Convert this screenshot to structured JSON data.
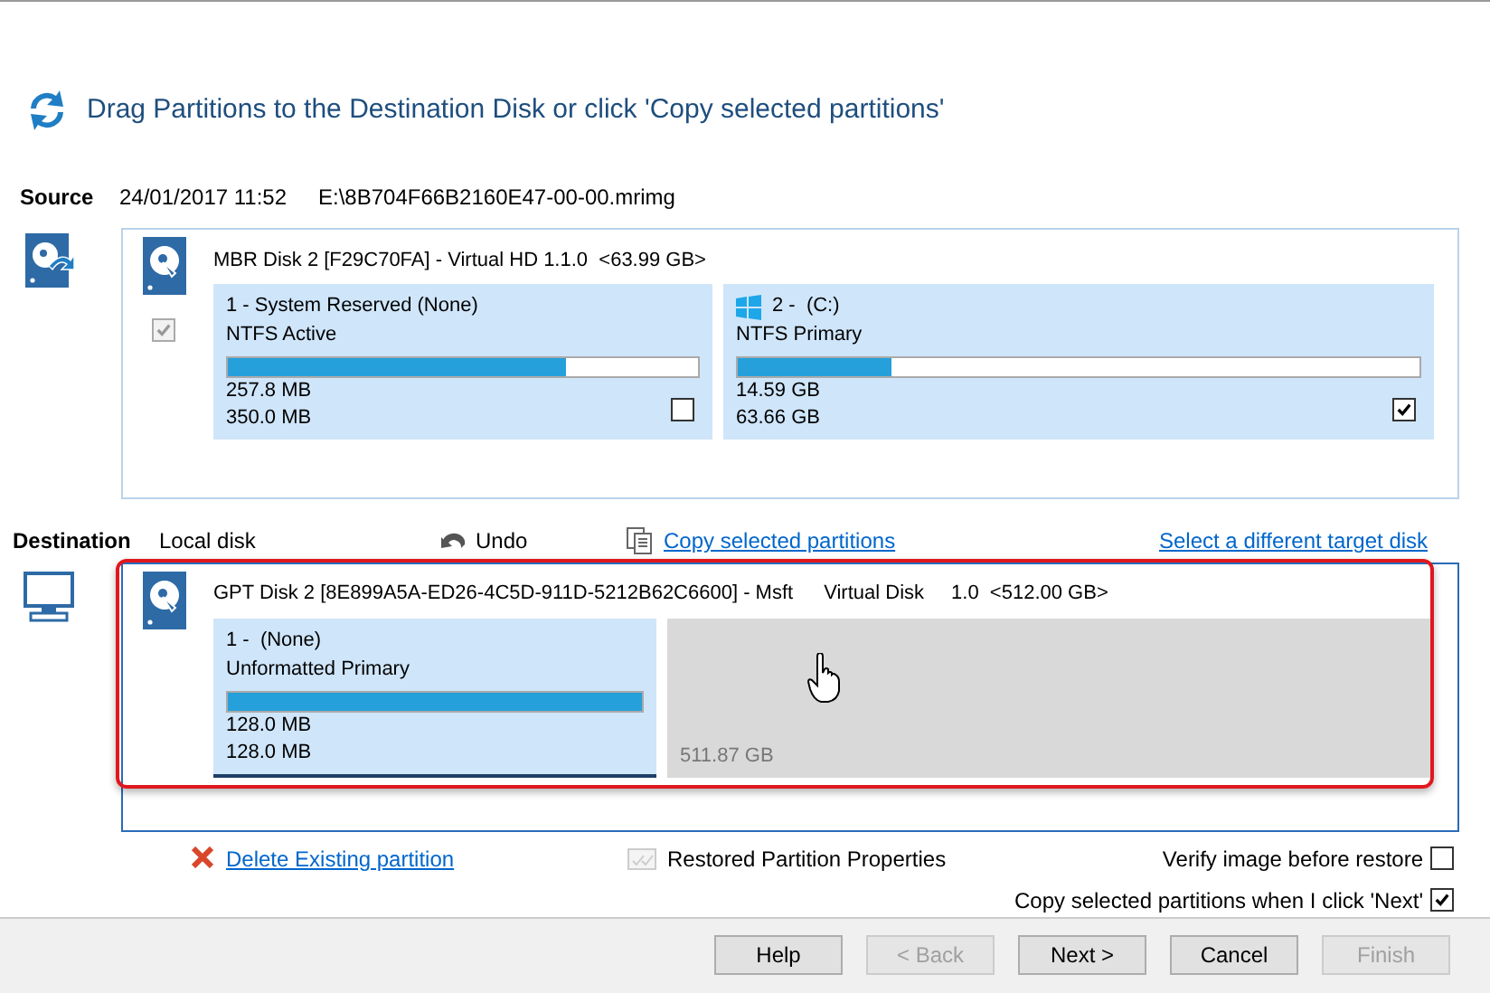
{
  "header": {
    "title": "Drag Partitions to the Destination Disk or click 'Copy selected partitions'"
  },
  "source": {
    "label": "Source",
    "date": "24/01/2017 11:52",
    "path": "E:\\8B704F66B2160E47-00-00.mrimg",
    "disk": {
      "title": "MBR Disk 2 [F29C70FA] - Virtual HD 1.1.0  <63.99 GB>",
      "checked": true,
      "disabled": true,
      "partitions": [
        {
          "kind": "partition",
          "title": "1 - System Reserved (None)",
          "windows_logo": false,
          "type": "NTFS Active",
          "level": 0.72,
          "used": "257.8 MB",
          "total": "350.0 MB",
          "checked": false
        },
        {
          "kind": "partition",
          "title": "2 -  (C:)",
          "windows_logo": true,
          "type": "NTFS Primary",
          "level": 0.225,
          "used": "14.59 GB",
          "total": "63.66 GB",
          "checked": true
        }
      ]
    }
  },
  "destination": {
    "label": "Destination",
    "location": "Local disk",
    "undo": "Undo",
    "copy_link": "Copy selected partitions",
    "select_link": "Select a different target disk",
    "disk": {
      "title": "GPT Disk 2 [8E899A5A-ED26-4C5D-911D-5212B62C6600] - Msft",
      "model": "Virtual Disk",
      "size": "1.0  <512.00 GB>",
      "highlighted": true,
      "partitions": [
        {
          "kind": "partition",
          "title": "1 -  (None)",
          "type": "Unformatted Primary",
          "level": 1,
          "used": "128.0 MB",
          "total": "128.0 MB",
          "selected": true
        },
        {
          "kind": "unallocated",
          "size": "511.87 GB"
        }
      ]
    }
  },
  "actions": {
    "delete_link": "Delete Existing partition",
    "properties": {
      "label": "Restored Partition Properties",
      "disabled": true
    }
  },
  "options": [
    {
      "label": "Verify image before restore",
      "checked": false
    },
    {
      "label": "Copy selected partitions when I click 'Next'",
      "checked": true
    }
  ],
  "buttons": [
    {
      "label": "Help",
      "disabled": false
    },
    {
      "label": "< Back",
      "disabled": true
    },
    {
      "label": "Next >",
      "disabled": false
    },
    {
      "label": "Cancel",
      "disabled": false
    },
    {
      "label": "Finish",
      "disabled": true
    }
  ]
}
